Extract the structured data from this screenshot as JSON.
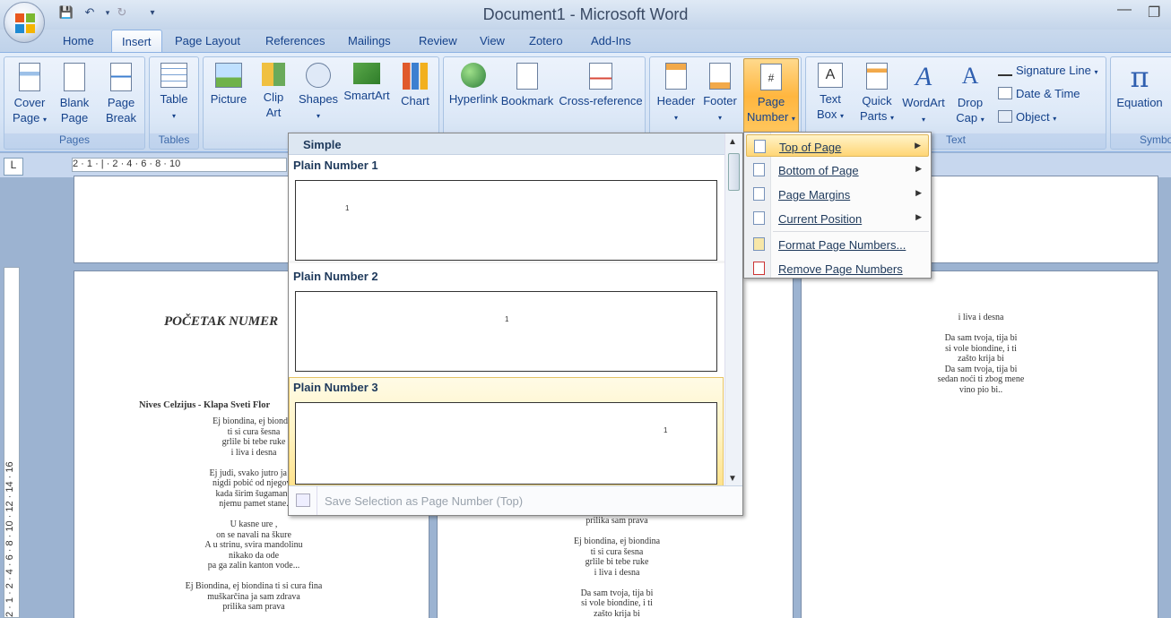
{
  "window": {
    "title": "Document1 - Microsoft Word"
  },
  "quick_access": [
    "save-icon",
    "undo-icon",
    "redo-icon",
    "customize-icon"
  ],
  "tabs": [
    "Home",
    "Insert",
    "Page Layout",
    "References",
    "Mailings",
    "Review",
    "View",
    "Zotero",
    "Add-Ins"
  ],
  "active_tab": "Insert",
  "ribbon": {
    "pages": {
      "label": "Pages",
      "cover_page": "Cover\nPage",
      "blank_page": "Blank\nPage",
      "page_break": "Page\nBreak"
    },
    "tables": {
      "label": "Tables",
      "table": "Table"
    },
    "illustrations": {
      "picture": "Picture",
      "clip_art": "Clip\nArt",
      "shapes": "Shapes",
      "smartart": "SmartArt",
      "chart": "Chart"
    },
    "links": {
      "hyperlink": "Hyperlink",
      "bookmark": "Bookmark",
      "cross_reference": "Cross-reference"
    },
    "header_footer": {
      "header": "Header",
      "footer": "Footer",
      "page_number": "Page\nNumber"
    },
    "text": {
      "label": "Text",
      "text_box": "Text\nBox",
      "quick_parts": "Quick\nParts",
      "wordart": "WordArt",
      "drop_cap": "Drop\nCap",
      "signature_line": "Signature Line",
      "date_time": "Date & Time",
      "object": "Object"
    },
    "symbols": {
      "label": "Symbo",
      "equation": "Equation"
    }
  },
  "ruler_text": "2 · 1 · | · 2 · 4 · 6 · 8 · 10",
  "vruler_text": "2 · 1 · 2 · 4 · 6 · 8 · 10 · 12 · 14 · 16",
  "gallery": {
    "section": "Simple",
    "items": [
      "Plain Number 1",
      "Plain Number 2",
      "Plain Number 3"
    ],
    "footer": "Save Selection as Page Number (Top)"
  },
  "menu": {
    "items": [
      "Top of Page",
      "Bottom of Page",
      "Page Margins",
      "Current Position",
      "Format Page Numbers...",
      "Remove Page Numbers"
    ]
  },
  "document": {
    "heading": "POČETAK NUMER",
    "song_title": "Nives Celzijus - Klapa Sveti Flor",
    "left_lines": [
      "Ej biondina, ej biondin",
      "ti si cura šesna",
      "grlile bi tebe ruke",
      "i liva i desna",
      "",
      "Ej judi, svako jutro ja do",
      "nigdi pobić od njegove",
      "kada širim šugamano",
      "njemu pamet stane.",
      "",
      "U kasne ure ,",
      "on se navali na škure",
      "A u strinu, svira mandolinu",
      "nikako da ode",
      "pa ga zalin kanton vode...",
      "",
      "Ej Biondina, ej biondina ti si cura fina",
      "muškarčina ja sam zdrava",
      "prilika sam prava"
    ],
    "middle_lines": [
      "prilika sam prava",
      "",
      "Ej biondina, ej biondina",
      "ti si cura šesna",
      "grlile bi tebe ruke",
      "i liva i desna",
      "",
      "Da sam tvoja, tija bi",
      "si vole biondine, i ti",
      "zašto krija bi"
    ],
    "right_lines": [
      "i liva i desna",
      "",
      "Da sam tvoja, tija bi",
      "si vole biondine, i ti",
      "zašto krija bi",
      "Da sam tvoja, tija bi",
      "sedan noći ti zbog mene",
      "vino pio bi.."
    ]
  }
}
